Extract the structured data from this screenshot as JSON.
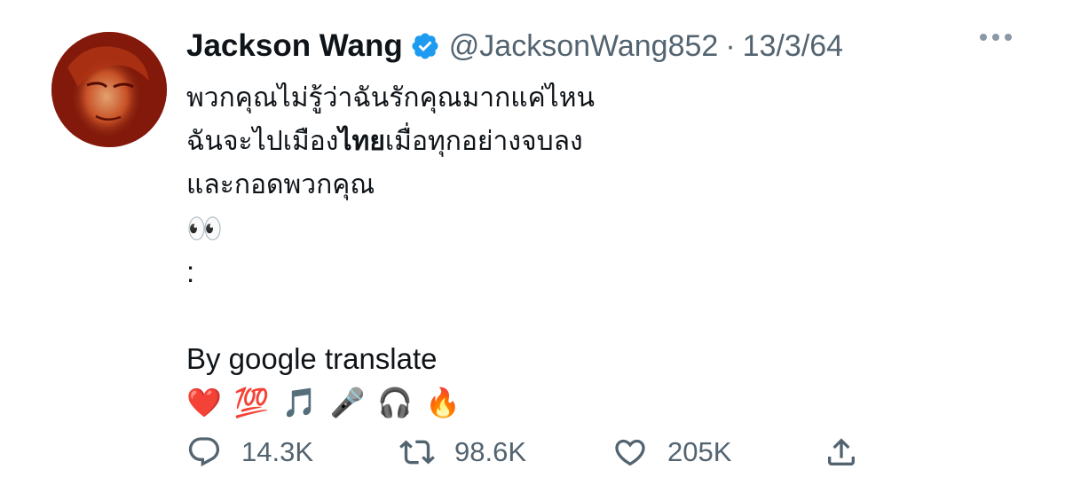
{
  "tweet": {
    "display_name": "Jackson Wang",
    "handle": "@JacksonWang852",
    "separator": "·",
    "date": "13/3/64",
    "lines": {
      "l1": "พวกคุณไม่รู้ว่าฉันรักคุณมากแค่ไหน",
      "l2_pre": "ฉันจะไปเมือง",
      "l2_bold": "ไทย",
      "l2_post": "เมื่อทุกอย่างจบลง",
      "l3": "และกอดพวกคุณ",
      "l4": "👀",
      "l5": ":",
      "l7": "By google translate"
    },
    "emojis": [
      "❤️",
      "💯",
      "🎵",
      "🎤",
      "🎧",
      "🔥"
    ],
    "stats": {
      "replies": "14.3K",
      "retweets": "98.6K",
      "likes": "205K"
    },
    "icons": {
      "verified": "verified-badge-icon",
      "more": "more-options-icon",
      "reply": "reply-icon",
      "retweet": "retweet-icon",
      "like": "heart-icon",
      "share": "share-icon"
    },
    "colors": {
      "verified": "#1d9bf0",
      "secondary_text": "#536471",
      "primary_text": "#0f1419"
    }
  }
}
